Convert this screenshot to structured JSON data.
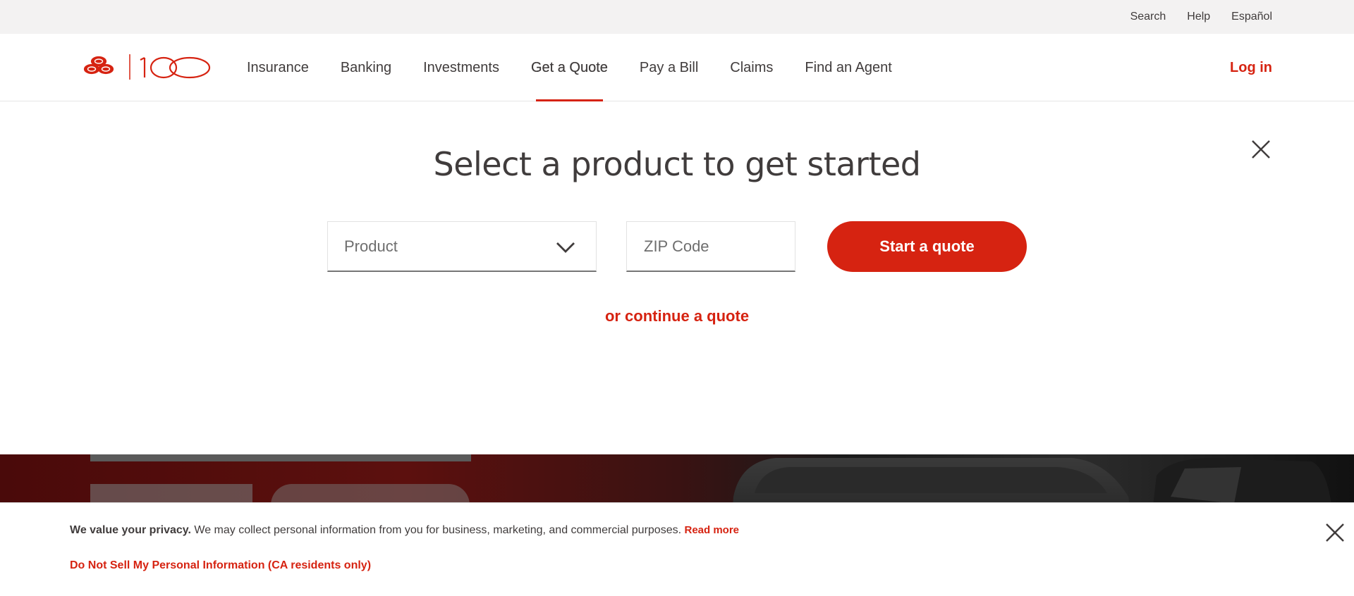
{
  "utility": {
    "search": "Search",
    "help": "Help",
    "language": "Español"
  },
  "logo": {
    "icon": "state-farm-three-ovals-logo",
    "text": "100",
    "color": "#d62311"
  },
  "nav": {
    "items": [
      {
        "label": "Insurance"
      },
      {
        "label": "Banking"
      },
      {
        "label": "Investments"
      },
      {
        "label": "Get a Quote",
        "active": true
      },
      {
        "label": "Pay a Bill"
      },
      {
        "label": "Claims"
      },
      {
        "label": "Find an Agent"
      }
    ],
    "login": "Log in"
  },
  "quote": {
    "title": "Select a product to get started",
    "product_placeholder": "Product",
    "zip_placeholder": "ZIP Code",
    "start_button": "Start a quote",
    "continue_link": "or continue a quote",
    "close_icon": "close-icon"
  },
  "privacy": {
    "lead": "We value your privacy.",
    "body": " We may collect personal information from you for business, marketing, and commercial purposes. ",
    "read_more": "Read more",
    "do_not_sell": "Do Not Sell My Personal Information (CA residents only)",
    "close_icon": "close-icon"
  },
  "colors": {
    "brand_red": "#d62311",
    "text_dark": "#403c3c",
    "utility_bg": "#f3f2f2"
  }
}
